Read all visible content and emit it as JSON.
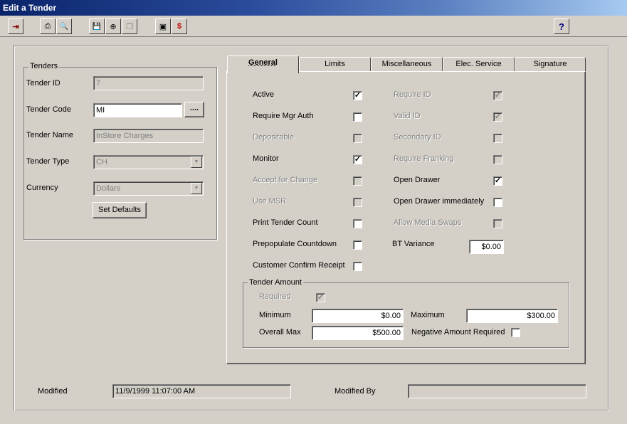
{
  "window": {
    "title": "Edit a Tender"
  },
  "toolbar": {
    "buttons": [
      {
        "name": "exit-icon",
        "glyph": "⇥"
      },
      {
        "name": "print-icon",
        "glyph": "⎙"
      },
      {
        "name": "print-preview-icon",
        "glyph": "🔍"
      },
      {
        "name": "save-icon",
        "glyph": "💾"
      },
      {
        "name": "save-new-icon",
        "glyph": "⊕"
      },
      {
        "name": "copy-icon",
        "glyph": "❐"
      },
      {
        "name": "screen-icon",
        "glyph": "▣"
      },
      {
        "name": "price-icon",
        "glyph": "$"
      }
    ],
    "help_glyph": "?"
  },
  "tenders": {
    "group_label": "Tenders",
    "tender_id_label": "Tender ID",
    "tender_id_value": "7",
    "tender_code_label": "Tender Code",
    "tender_code_value": "MI",
    "lookup_glyph": "....",
    "tender_name_label": "Tender Name",
    "tender_name_value": "InStore Charges",
    "tender_type_label": "Tender Type",
    "tender_type_value": "CH",
    "currency_label": "Currency",
    "currency_value": "Dollars",
    "set_defaults_label": "Set Defaults"
  },
  "tabs": [
    "General",
    "Limits",
    "Miscellaneous",
    "Elec. Service",
    "Signature"
  ],
  "general": {
    "left": [
      {
        "label": "Active",
        "checked": true,
        "disabled": false
      },
      {
        "label": "Require Mgr Auth",
        "checked": false,
        "disabled": false
      },
      {
        "label": "Depositable",
        "checked": false,
        "disabled": true
      },
      {
        "label": "Monitor",
        "checked": true,
        "disabled": false
      },
      {
        "label": "Accept for Change",
        "checked": false,
        "disabled": true
      },
      {
        "label": "Use MSR",
        "checked": false,
        "disabled": true
      },
      {
        "label": "Print Tender Count",
        "checked": false,
        "disabled": false
      },
      {
        "label": "Prepopulate Countdown",
        "checked": false,
        "disabled": false
      },
      {
        "label": "Customer Confirm Receipt",
        "checked": false,
        "disabled": false
      }
    ],
    "right": [
      {
        "label": "Require ID",
        "checked": true,
        "disabled": true
      },
      {
        "label": "Valid ID",
        "checked": true,
        "disabled": true
      },
      {
        "label": "Secondary ID",
        "checked": false,
        "disabled": true
      },
      {
        "label": "Require Franking",
        "checked": false,
        "disabled": true
      },
      {
        "label": "Open Drawer",
        "checked": true,
        "disabled": false
      },
      {
        "label": "Open Drawer immediately",
        "checked": false,
        "disabled": false
      },
      {
        "label": "Allow Media Swaps",
        "checked": false,
        "disabled": true
      }
    ],
    "bt_variance_label": "BT Variance",
    "bt_variance_value": "$0.00",
    "tender_amount": {
      "group_label": "Tender Amount",
      "required_label": "Required",
      "required_checked": true,
      "minimum_label": "Minimum",
      "minimum_value": "$0.00",
      "maximum_label": "Maximum",
      "maximum_value": "$300.00",
      "overall_max_label": "Overall Max",
      "overall_max_value": "$500.00",
      "negative_label": "Negative Amount Required",
      "negative_checked": false
    }
  },
  "footer": {
    "modified_label": "Modified",
    "modified_value": "11/9/1999 11:07:00 AM",
    "modified_by_label": "Modified By",
    "modified_by_value": ""
  },
  "check_glyph": "✓"
}
